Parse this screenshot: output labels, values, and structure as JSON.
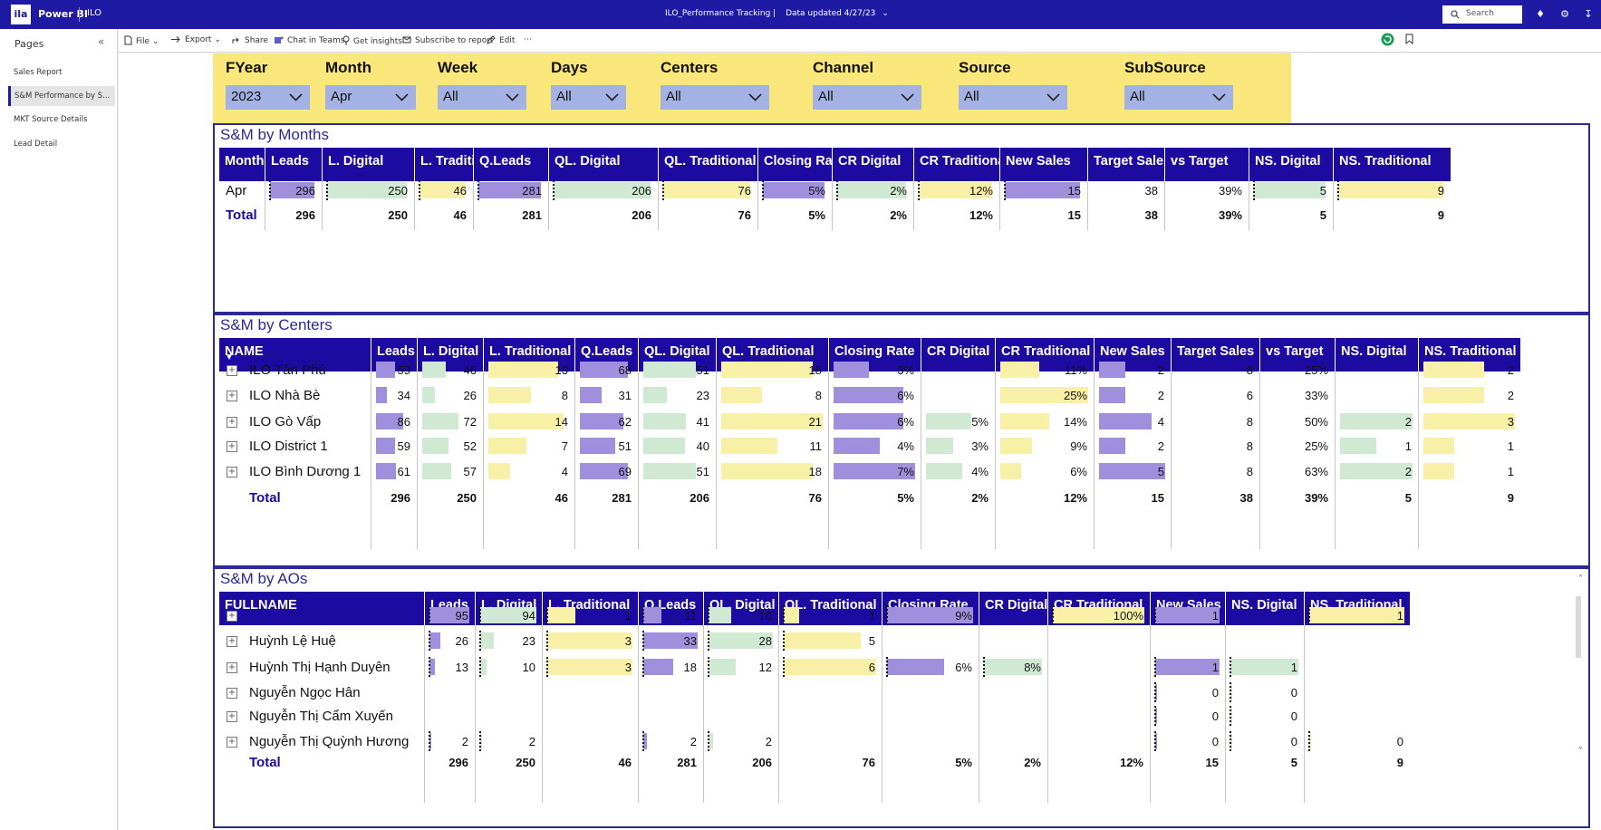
{
  "topbar": {
    "logo": "ila",
    "brand": "Power BI",
    "workspace": "ILO",
    "report_title": "ILO_Performance Tracking  |",
    "data_updated": "Data updated 4/27/23",
    "search_placeholder": "Search"
  },
  "sidebar": {
    "header": "Pages",
    "pages": [
      {
        "label": "Sales Report",
        "active": false
      },
      {
        "label": "S&M Performance by S...",
        "active": true
      },
      {
        "label": "MKT Source Details",
        "active": false
      },
      {
        "label": "Lead Detail",
        "active": false
      }
    ]
  },
  "commandbar": {
    "file": "File",
    "export": "Export",
    "share": "Share",
    "chat": "Chat in Teams",
    "insights": "Get insights",
    "subscribe": "Subscribe to report",
    "edit": "Edit"
  },
  "slicers": [
    {
      "label": "FYear",
      "value": "2023"
    },
    {
      "label": "Month",
      "value": "Apr"
    },
    {
      "label": "Week",
      "value": "All"
    },
    {
      "label": "Days",
      "value": "All"
    },
    {
      "label": "Centers",
      "value": "All"
    },
    {
      "label": "Channel",
      "value": "All"
    },
    {
      "label": "Source",
      "value": "All"
    },
    {
      "label": "SubSource",
      "value": "All"
    }
  ],
  "colors": {
    "purple_bar": "#9f8fdc",
    "green_bar": "#cfe9d2",
    "yellow_bar": "#f8f0a6",
    "header": "#1d0aa0",
    "slicer_bg": "#f9e77c",
    "slicer_box": "#a4b2e3",
    "topbar": "#1f1aa4"
  },
  "months": {
    "title": "S&M by Months",
    "headers": [
      "Month",
      "Leads",
      "L. Digital",
      "L. Traditional",
      "Q.Leads",
      "QL. Digital",
      "QL. Traditional",
      "Closing Rate",
      "CR Digital",
      "CR Traditional",
      "New Sales",
      "Target Sales",
      "vs Target",
      "NS. Digital",
      "NS. Traditional"
    ],
    "rows": [
      {
        "label": "Apr",
        "values": [
          "296",
          "250",
          "46",
          "281",
          "206",
          "76",
          "5%",
          "2%",
          "12%",
          "15",
          "38",
          "39%",
          "5",
          "9"
        ]
      }
    ],
    "total": {
      "label": "Total",
      "values": [
        "296",
        "250",
        "46",
        "281",
        "206",
        "76",
        "5%",
        "2%",
        "12%",
        "15",
        "38",
        "39%",
        "5",
        "9"
      ]
    }
  },
  "centers": {
    "title": "S&M by Centers",
    "headers": [
      "NAME",
      "Leads",
      "L. Digital",
      "L. Traditional",
      "Q.Leads",
      "QL. Digital",
      "QL. Traditional",
      "Closing Rate",
      "CR Digital",
      "CR Traditional",
      "New Sales",
      "Target Sales",
      "vs Target",
      "NS. Digital",
      "NS. Traditional"
    ],
    "sort_indicator": "▼",
    "rows": [
      {
        "label": "ILO Tân Phú",
        "values": [
          "59",
          "46",
          "13",
          "68",
          "51",
          "18",
          "3%",
          "",
          "11%",
          "2",
          "8",
          "25%",
          "",
          "2"
        ]
      },
      {
        "label": "ILO Nhà Bè",
        "values": [
          "34",
          "26",
          "8",
          "31",
          "23",
          "8",
          "6%",
          "",
          "25%",
          "2",
          "6",
          "33%",
          "",
          "2"
        ]
      },
      {
        "label": "ILO Gò Vấp",
        "values": [
          "86",
          "72",
          "14",
          "62",
          "41",
          "21",
          "6%",
          "5%",
          "14%",
          "4",
          "8",
          "50%",
          "2",
          "3"
        ]
      },
      {
        "label": "ILO District 1",
        "values": [
          "59",
          "52",
          "7",
          "51",
          "40",
          "11",
          "4%",
          "3%",
          "9%",
          "2",
          "8",
          "25%",
          "1",
          "1"
        ]
      },
      {
        "label": "ILO Bình Dương 1",
        "values": [
          "61",
          "57",
          "4",
          "69",
          "51",
          "18",
          "7%",
          "4%",
          "6%",
          "5",
          "8",
          "63%",
          "2",
          "1"
        ]
      }
    ],
    "total": {
      "label": "Total",
      "values": [
        "296",
        "250",
        "46",
        "281",
        "206",
        "76",
        "5%",
        "2%",
        "12%",
        "15",
        "38",
        "39%",
        "5",
        "9"
      ]
    }
  },
  "aos": {
    "title": "S&M by AOs",
    "headers": [
      "FULLNAME",
      "Leads",
      "L. Digital",
      "L. Traditional",
      "Q.Leads",
      "QL. Digital",
      "QL. Traditional",
      "Closing Rate",
      "CR Digital",
      "CR Traditional",
      "New Sales",
      "NS. Digital",
      "NS. Traditional"
    ],
    "rows": [
      {
        "label": "",
        "values": [
          "95",
          "94",
          "1",
          "11",
          "10",
          "1",
          "9%",
          "",
          "100%",
          "1",
          "",
          "1"
        ]
      },
      {
        "label": "Huỳnh Lệ Huệ",
        "values": [
          "26",
          "23",
          "3",
          "33",
          "28",
          "5",
          "",
          "",
          "",
          "",
          "",
          ""
        ]
      },
      {
        "label": "Huỳnh Thị Hạnh Duyên",
        "values": [
          "13",
          "10",
          "3",
          "18",
          "12",
          "6",
          "6%",
          "8%",
          "",
          "1",
          "1",
          ""
        ]
      },
      {
        "label": "Nguyễn Ngọc Hân",
        "values": [
          "",
          "",
          "",
          "",
          "",
          "",
          "",
          "",
          "",
          "0",
          "0",
          ""
        ]
      },
      {
        "label": "Nguyễn Thị Cẩm Xuyến",
        "values": [
          "",
          "",
          "",
          "",
          "",
          "",
          "",
          "",
          "",
          "0",
          "0",
          ""
        ]
      },
      {
        "label": "Nguyễn Thị Quỳnh Hương",
        "values": [
          "2",
          "2",
          "",
          "2",
          "2",
          "",
          "",
          "",
          "",
          "0",
          "0",
          "0"
        ]
      }
    ],
    "total": {
      "label": "Total",
      "values": [
        "296",
        "250",
        "46",
        "281",
        "206",
        "76",
        "5%",
        "2%",
        "12%",
        "15",
        "5",
        "9"
      ]
    }
  }
}
